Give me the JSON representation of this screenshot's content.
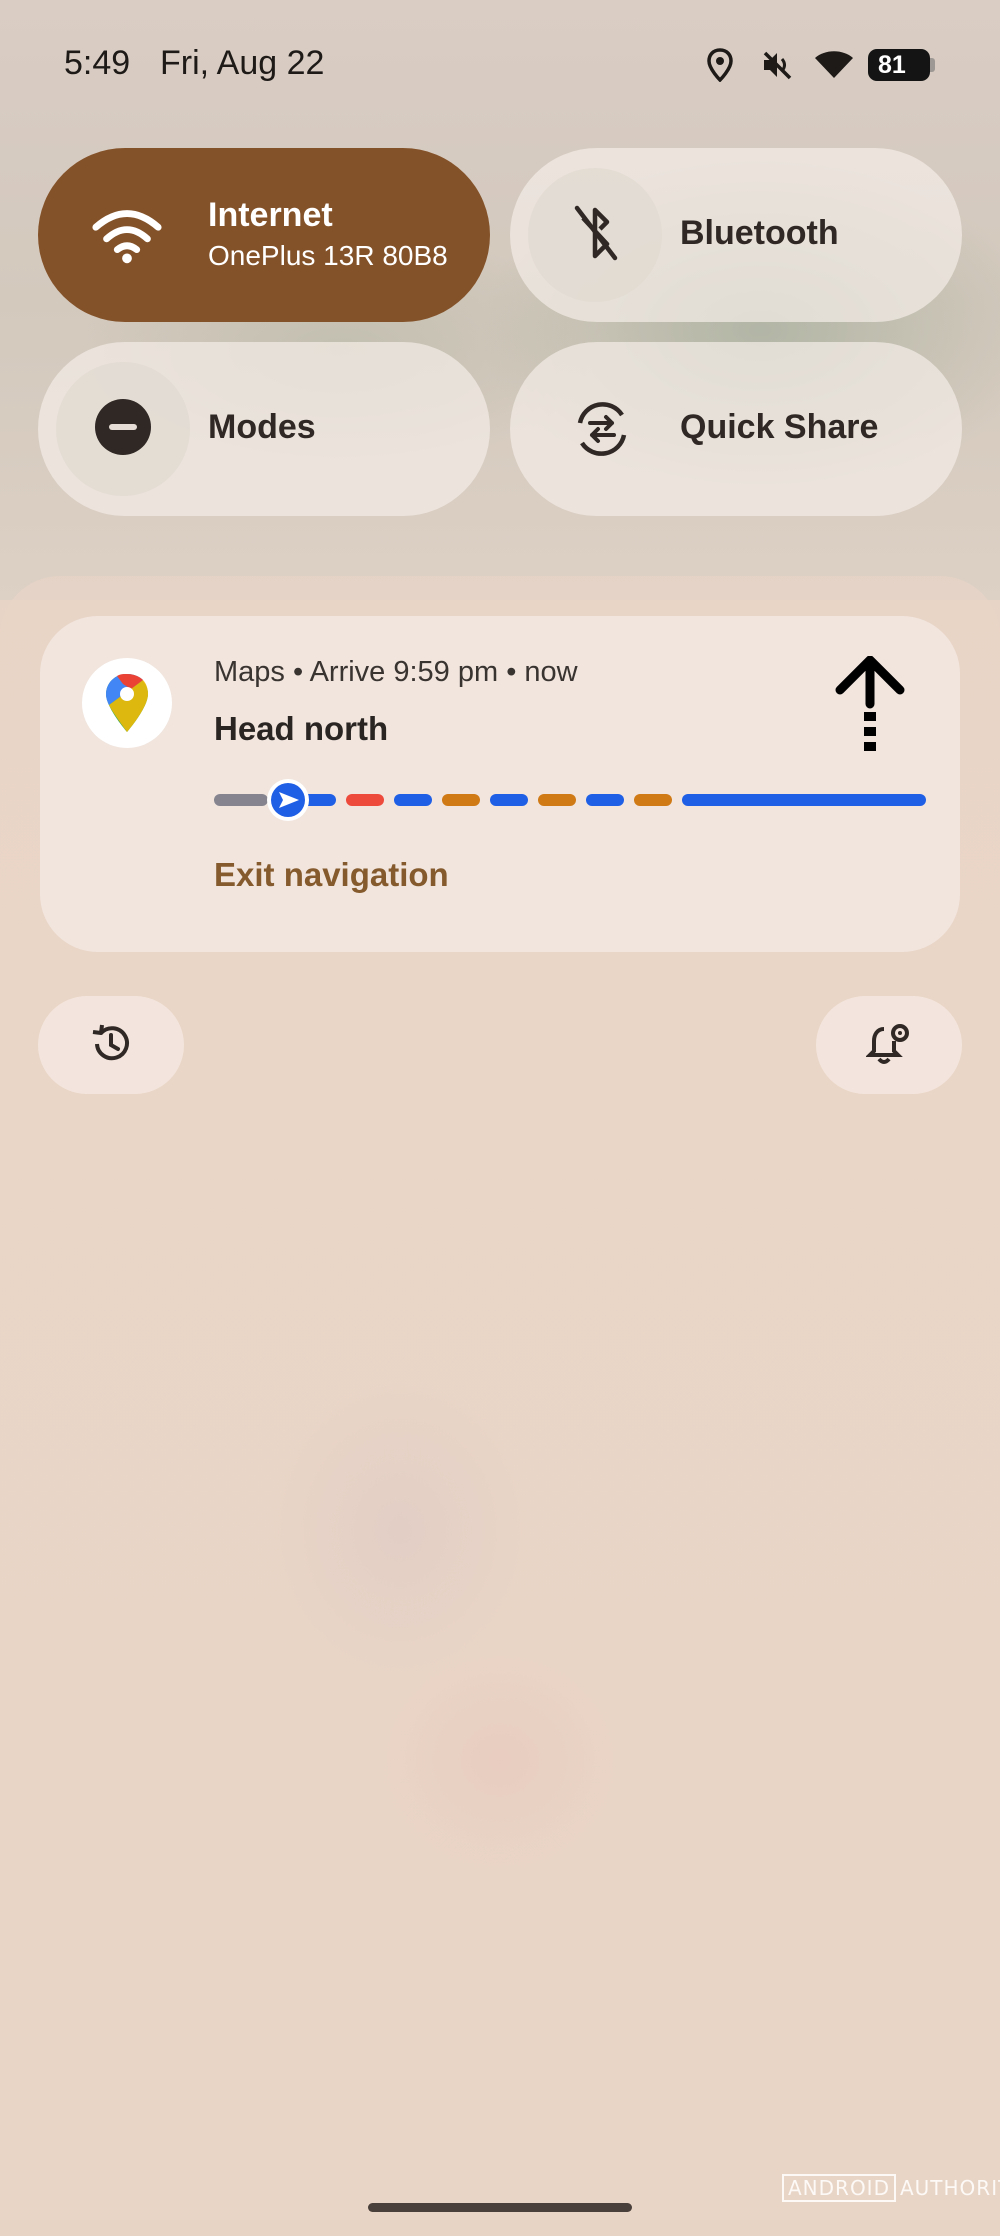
{
  "status_bar": {
    "time": "5:49",
    "date": "Fri, Aug 22",
    "battery": "81",
    "icons": [
      "location-icon",
      "vibrate-off-icon",
      "wifi-icon",
      "battery-icon"
    ]
  },
  "tiles": [
    {
      "label": "Internet",
      "sublabel": "OnePlus 13R 80B8",
      "icon": "wifi-icon",
      "active": true
    },
    {
      "label": "Bluetooth",
      "icon": "bluetooth-off-icon",
      "active": false
    },
    {
      "label": "Modes",
      "icon": "modes-icon",
      "active": false
    },
    {
      "label": "Quick Share",
      "icon": "quick-share-icon",
      "active": false
    }
  ],
  "notification": {
    "app_icon": "google-maps-icon",
    "header": "Maps • Arrive 9:59 pm • now",
    "title": "Head north",
    "action": "Exit navigation",
    "direction_icon": "arrow-up-icon",
    "route_segment_colors": [
      "#1f5fe6",
      "#ee4a3b",
      "#1f5fe6",
      "#d07a16",
      "#1f5fe6",
      "#d07a16",
      "#1f5fe6",
      "#d07a16",
      "#1f5fe6"
    ]
  },
  "buttons": {
    "history_icon": "history-icon",
    "settings_icon": "notification-settings-icon"
  },
  "watermark": {
    "brand_box": "ANDROID",
    "brand_rest": "AUTHORITY"
  },
  "colors": {
    "active_tile": "#845229",
    "accent_text": "#855a2c",
    "route_blue": "#1f5fe6"
  }
}
